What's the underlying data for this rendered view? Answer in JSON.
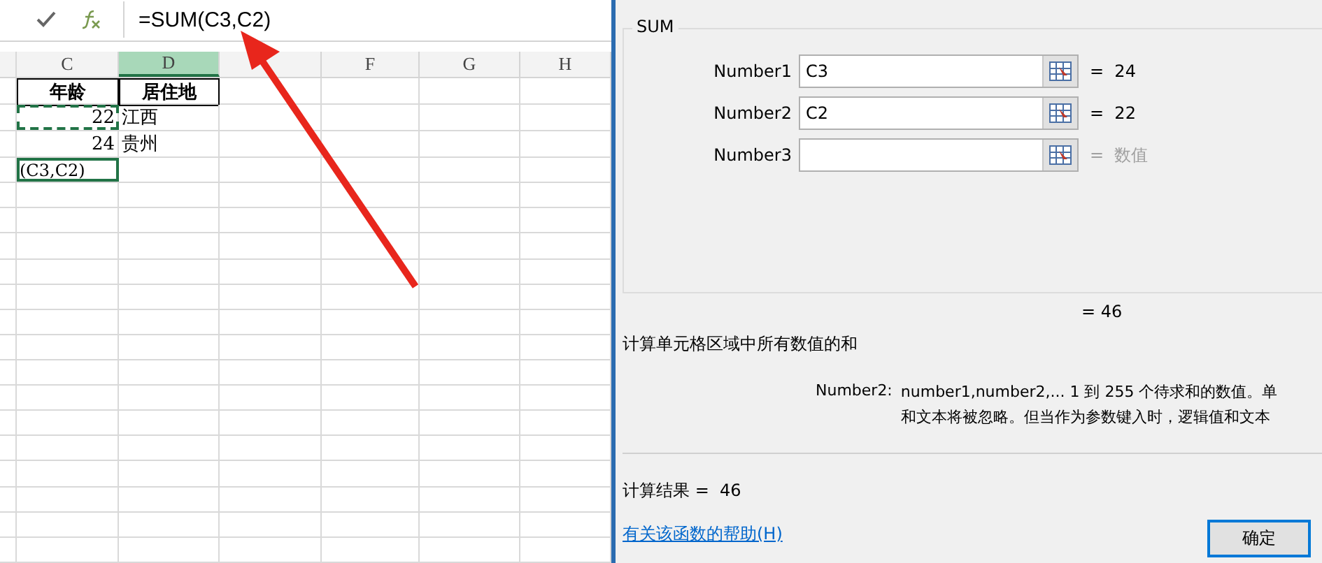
{
  "formula_bar": {
    "formula": "=SUM(C3,C2)"
  },
  "sheet": {
    "columns": [
      {
        "label": "C",
        "selected": false
      },
      {
        "label": "D",
        "selected": true
      },
      {
        "selected": false
      },
      {
        "label": "F",
        "selected": false
      },
      {
        "label": "G",
        "selected": false
      },
      {
        "label": "H",
        "selected": false
      }
    ],
    "rows": [
      {
        "cells": [
          {
            "text": "年龄",
            "kind": "header"
          },
          {
            "text": "居住地",
            "kind": "header"
          }
        ]
      },
      {
        "cells": [
          {
            "text": "22",
            "kind": "copied"
          },
          {
            "text": "江西",
            "kind": "text"
          }
        ]
      },
      {
        "cells": [
          {
            "text": "24",
            "kind": "number"
          },
          {
            "text": "贵州",
            "kind": "text"
          }
        ]
      },
      {
        "cells": [
          {
            "text": "(C3,C2)",
            "kind": "editing"
          }
        ]
      }
    ]
  },
  "dialog": {
    "group": "SUM",
    "args": [
      {
        "label": "Number1",
        "value": "C3",
        "result": "=  24",
        "placeholder": false
      },
      {
        "label": "Number2",
        "value": "C2",
        "result": "=  22",
        "placeholder": false
      },
      {
        "label": "Number3",
        "result": "=  数值",
        "placeholder": true
      }
    ],
    "total": "= 46",
    "description": "计算单元格区域中所有数值的和",
    "arg_help_label": "Number2:",
    "arg_help": [
      "number1,number2,...  1 到 255 个待求和的数值。单",
      "和文本将被忽略。但当作为参数键入时，逻辑值和文本"
    ],
    "result": "计算结果 =  46",
    "help_link": "有关该函数的帮助(H)",
    "ok": "确定"
  }
}
